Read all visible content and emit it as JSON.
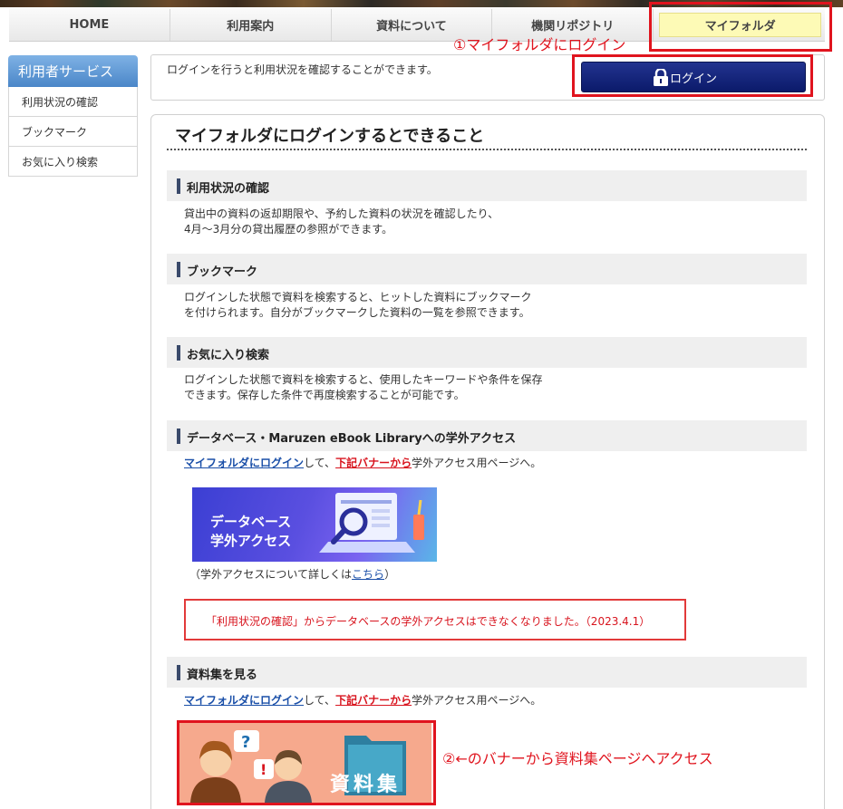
{
  "nav": {
    "items": [
      "HOME",
      "利用案内",
      "資料について",
      "機関リポジトリ",
      "マイフォルダ"
    ]
  },
  "annotations": {
    "note1": "①マイフォルダにログイン",
    "note2": "②←のバナーから資料集ページへアクセス"
  },
  "sidebar": {
    "title": "利用者サービス",
    "items": [
      "利用状況の確認",
      "ブックマーク",
      "お気に入り検索"
    ]
  },
  "login": {
    "text": "ログインを行うと利用状況を確認することができます。",
    "button": "ログイン"
  },
  "main": {
    "title": "マイフォルダにログインするとできること",
    "sections": [
      {
        "heading": "利用状況の確認",
        "line1": "貸出中の資料の返却期限や、予約した資料の状況を確認したり、",
        "line2": "4月～3月分の貸出履歴の参照ができます。"
      },
      {
        "heading": "ブックマーク",
        "line1": "ログインした状態で資料を検索すると、ヒットした資料にブックマーク",
        "line2": "を付けられます。自分がブックマークした資料の一覧を参照できます。"
      },
      {
        "heading": "お気に入り検索",
        "line1": "ログインした状態で資料を検索すると、使用したキーワードや条件を保存",
        "line2": "できます。保存した条件で再度検索することが可能です。"
      },
      {
        "heading": "データベース・Maruzen eBook Libraryへの学外アクセス",
        "link1": "マイフォルダにログイン",
        "mid": "して、",
        "link2": "下記バナーから",
        "tail": "学外アクセス用ページへ。",
        "banner": "データベース\n学外アクセス",
        "detail_prefix": "（学外アクセスについて詳しくは",
        "detail_link": "こちら",
        "detail_suffix": "）",
        "notice": "「利用状況の確認」からデータベースの学外アクセスはできなくなりました。（2023.4.1）"
      },
      {
        "heading": "資料集を見る",
        "link1": "マイフォルダにログイン",
        "mid": "して、",
        "link2": "下記バナーから",
        "tail": "学外アクセス用ページへ。",
        "banner": "資料集"
      }
    ]
  },
  "colors": {
    "accent_red": "#e0141e",
    "nav_active": "#fdfab6",
    "login_button": "#0b1a6a"
  }
}
